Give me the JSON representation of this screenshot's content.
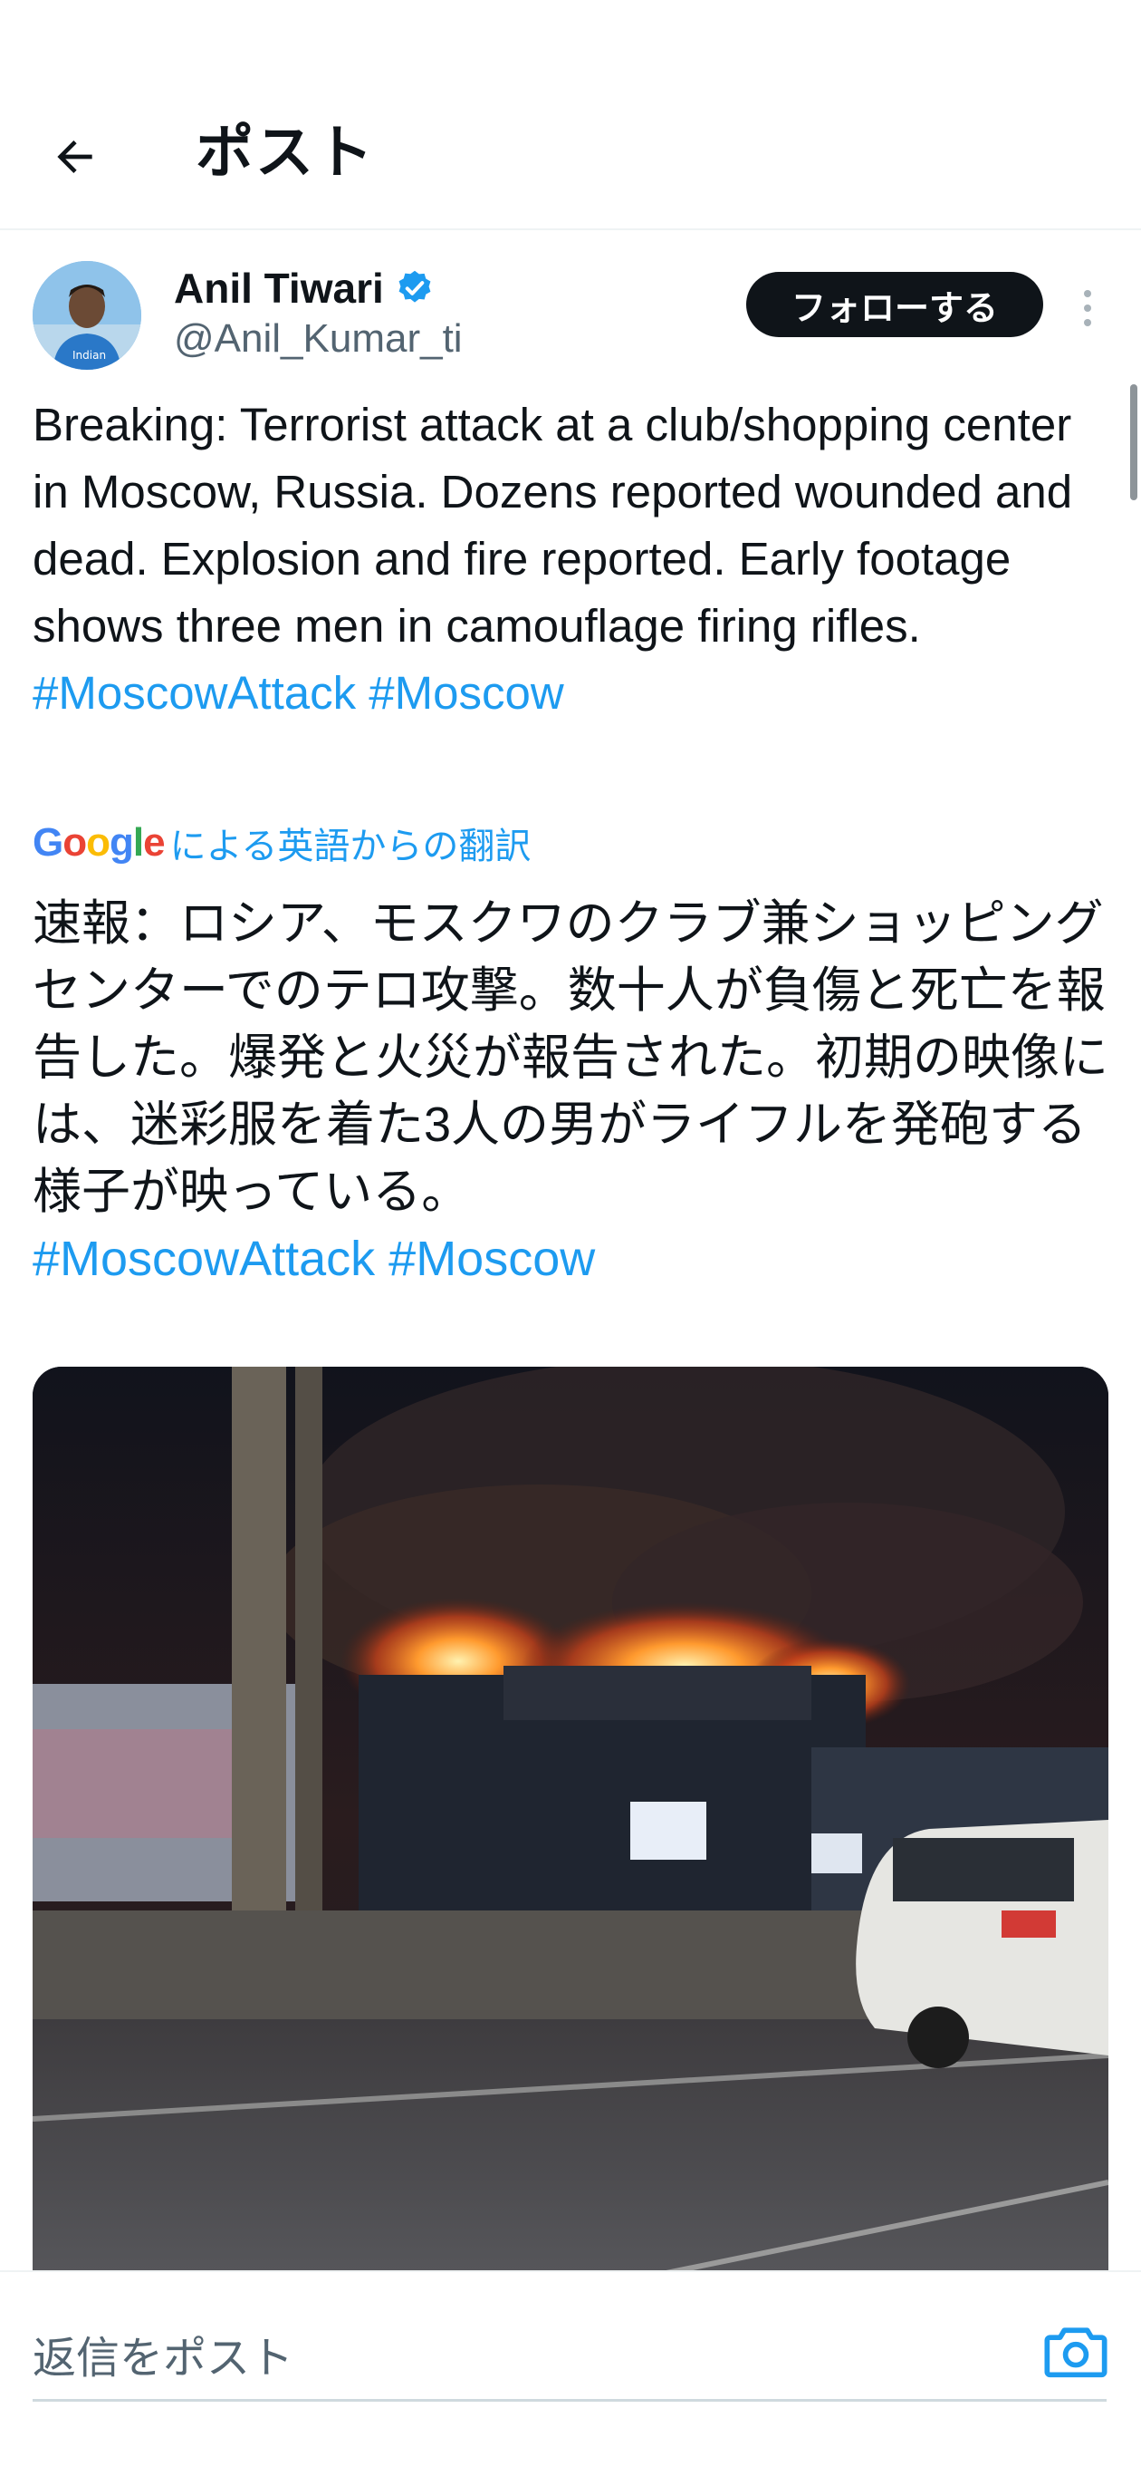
{
  "header": {
    "title": "ポスト",
    "back_icon": "arrow-left-icon"
  },
  "author": {
    "name": "Anil Tiwari",
    "handle": "@Anil_Kumar_ti",
    "verified_icon": "verified-badge-icon",
    "follow_label": "フォローする",
    "more_icon": "more-vertical-icon"
  },
  "tweet": {
    "text": "Breaking: Terrorist attack at a club/shopping center in Moscow, Russia. Dozens reported wounded and dead. Explosion and fire reported. Early footage shows three men in camouflage firing rifles.",
    "hashtag1": "#MoscowAttack",
    "hashtag2": "#Moscow"
  },
  "translation": {
    "brand": "Google",
    "label": "による英語からの翻訳",
    "text": "速報：ロシア、モスクワのクラブ兼ショッピングセンターでのテロ攻撃。数十人が負傷と死亡を報告した。爆発と火災が報告された。初期の映像には、迷彩服を着た3人の男がライフルを発砲する様子が映っている。",
    "hashtag1": "#MoscowAttack",
    "hashtag2": "#Moscow"
  },
  "media": {
    "description_icon": "photo-building-fire"
  },
  "reply": {
    "placeholder": "返信をポスト",
    "camera_icon": "camera-icon"
  },
  "colors": {
    "link": "#1d9bf0",
    "text": "#0f1419",
    "secondary": "#536471",
    "button": "#0f1419"
  }
}
